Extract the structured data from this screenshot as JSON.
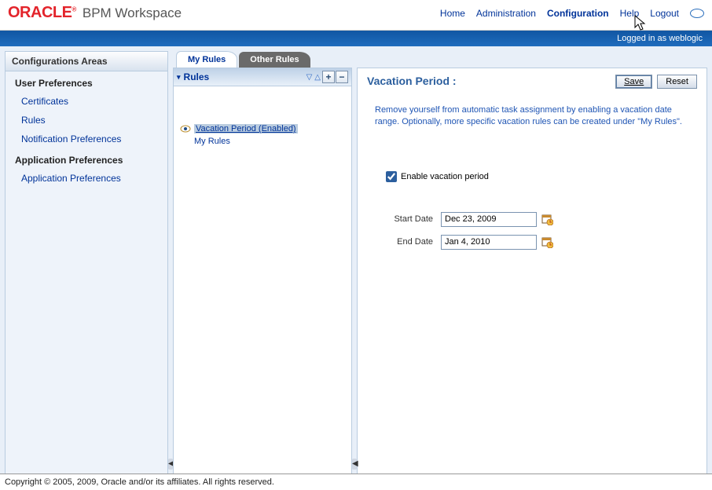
{
  "brand": {
    "logo": "ORACLE",
    "suffix": "®",
    "product": "BPM Workspace"
  },
  "topnav": {
    "home": "Home",
    "admin": "Administration",
    "config": "Configuration",
    "help": "Help",
    "logout": "Logout"
  },
  "loginbar": "Logged in as weblogic",
  "leftcol": {
    "header": "Configurations Areas",
    "section1": "User Preferences",
    "items1": {
      "cert": "Certificates",
      "rules": "Rules",
      "notif": "Notification Preferences"
    },
    "section2": "Application Preferences",
    "items2": {
      "appprefs": "Application Preferences"
    }
  },
  "tabs": {
    "my": "My Rules",
    "other": "Other Rules"
  },
  "rules": {
    "header": "Rules",
    "item_selected": "Vacation Period (Enabled)",
    "item_sub": "My Rules"
  },
  "right": {
    "title": "Vacation Period :",
    "save": "Save",
    "reset": "Reset",
    "desc": "Remove yourself from automatic task assignment by enabling a vacation date range. Optionally, more specific vacation rules can be created under \"My Rules\".",
    "enable_label": "Enable vacation period",
    "start_label": "Start Date",
    "start_val": "Dec 23, 2009",
    "end_label": "End Date",
    "end_val": "Jan 4, 2010"
  },
  "footer": "Copyright © 2005, 2009, Oracle and/or its affiliates. All rights reserved."
}
